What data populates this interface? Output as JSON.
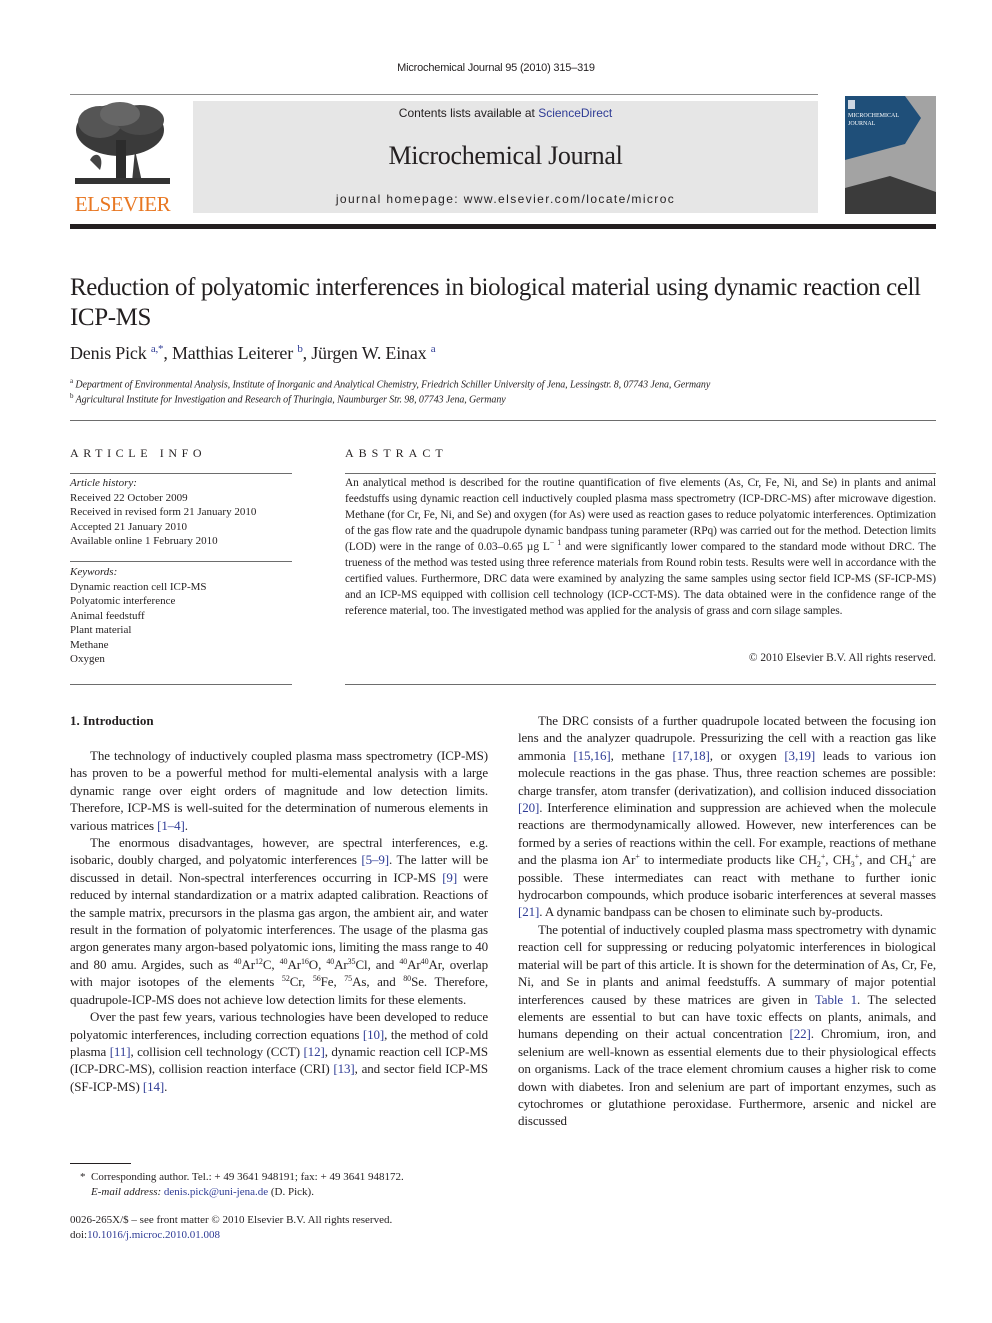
{
  "header": {
    "running_head": "Microchemical Journal 95 (2010) 315–319",
    "contents_prefix": "Contents lists available at ",
    "contents_link": "ScienceDirect",
    "journal_name": "Microchemical Journal",
    "homepage_prefix": "journal homepage: ",
    "homepage_url": "www.elsevier.com/locate/microc",
    "publisher_logo_text": "ELSEVIER",
    "cover_title_line1": "MICROCHEMICAL",
    "cover_title_line2": "JOURNAL",
    "colors": {
      "publisher_orange": "#e87722",
      "link_blue": "#2e3b95",
      "cover_blue": "#1f4f79",
      "banner_gray": "#e6e6e6"
    }
  },
  "article": {
    "title": "Reduction of polyatomic interferences in biological material using dynamic reaction cell ICP-MS",
    "authors": [
      {
        "name": "Denis Pick",
        "marks": "a,*"
      },
      {
        "name": "Matthias Leiterer",
        "marks": "b"
      },
      {
        "name": "Jürgen W. Einax",
        "marks": "a"
      }
    ],
    "affiliations": [
      {
        "mark": "a",
        "text": "Department of Environmental Analysis, Institute of Inorganic and Analytical Chemistry, Friedrich Schiller University of Jena, Lessingstr. 8, 07743 Jena, Germany"
      },
      {
        "mark": "b",
        "text": "Agricultural Institute for Investigation and Research of Thuringia, Naumburger Str. 98, 07743 Jena, Germany"
      }
    ]
  },
  "article_info": {
    "heading": "ARTICLE INFO",
    "history_label": "Article history:",
    "history": [
      "Received 22 October 2009",
      "Received in revised form 21 January 2010",
      "Accepted 21 January 2010",
      "Available online 1 February 2010"
    ],
    "keywords_label": "Keywords:",
    "keywords": [
      "Dynamic reaction cell ICP-MS",
      "Polyatomic interference",
      "Animal feedstuff",
      "Plant material",
      "Methane",
      "Oxygen"
    ]
  },
  "abstract": {
    "heading": "ABSTRACT",
    "text_part1": "An analytical method is described for the routine quantification of five elements (As, Cr, Fe, Ni, and Se) in plants and animal feedstuffs using dynamic reaction cell inductively coupled plasma mass spectrometry (ICP-DRC-MS) after microwave digestion. Methane (for Cr, Fe, Ni, and Se) and oxygen (for As) were used as reaction gases to reduce polyatomic interferences. Optimization of the gas flow rate and the quadrupole dynamic bandpass tuning parameter (RPq) was carried out for the method. Detection limits (LOD) were in the range of 0.03–0.65 µg L",
    "unit_exponent": "− 1",
    "text_part2": " and were significantly lower compared to the standard mode without DRC. The trueness of the method was tested using three reference materials from Round robin tests. Results were well in accordance with the certified values. Furthermore, DRC data were examined by analyzing the same samples using sector field ICP-MS (SF-ICP-MS) and an ICP-MS equipped with collision cell technology (ICP-CCT-MS). The data obtained were in the confidence range of the reference material, too. The investigated method was applied for the analysis of grass and corn silage samples.",
    "copyright": "© 2010 Elsevier B.V. All rights reserved."
  },
  "body": {
    "section_heading": "1. Introduction",
    "left": {
      "p1_text": "The technology of inductively coupled plasma mass spectrometry (ICP-MS) has proven to be a powerful method for multi-elemental analysis with a large dynamic range over eight orders of magnitude and low detection limits. Therefore, ICP-MS is well-suited for the determination of numerous elements in various matrices ",
      "p1_ref": "[1–4]",
      "p2_a": "The enormous disadvantages, however, are spectral interferences, e.g. isobaric, doubly charged, and polyatomic interferences ",
      "p2_ref1": "[5–9]",
      "p2_b": ". The latter will be discussed in detail. Non-spectral interferences occurring in ICP-MS ",
      "p2_ref2": "[9]",
      "p2_c": " were reduced by internal standardization or a matrix adapted calibration. Reactions of the sample matrix, precursors in the plasma gas argon, the ambient air, and water result in the formation of polyatomic interferences. The usage of the plasma gas argon generates many argon-based polyatomic ions, limiting the mass range to 40 and 80 amu. Argides, such as ",
      "argides": [
        {
          "m1": "40",
          "e1": "Ar",
          "m2": "12",
          "e2": "C"
        },
        {
          "m1": "40",
          "e1": "Ar",
          "m2": "16",
          "e2": "O"
        },
        {
          "m1": "40",
          "e1": "Ar",
          "m2": "35",
          "e2": "Cl"
        },
        {
          "m1": "40",
          "e1": "Ar",
          "m2": "40",
          "e2": "Ar"
        }
      ],
      "isotopes": [
        {
          "m": "52",
          "e": "Cr"
        },
        {
          "m": "56",
          "e": "Fe"
        },
        {
          "m": "75",
          "e": "As"
        },
        {
          "m": "80",
          "e": "Se"
        }
      ],
      "p2_d": ", overlap with major isotopes of the elements ",
      "p2_e": ". Therefore, quadrupole-ICP-MS does not achieve low detection limits for these elements.",
      "p3_a": "Over the past few years, various technologies have been developed to reduce polyatomic interferences, including correction equations ",
      "p3_ref1": "[10]",
      "p3_b": ", the method of cold plasma ",
      "p3_ref2": "[11]",
      "p3_c": ", collision cell technology (CCT) ",
      "p3_ref3": "[12]",
      "p3_d": ", dynamic reaction cell ICP-MS (ICP-DRC-MS), collision reaction interface (CRI) ",
      "p3_ref4": "[13]",
      "p3_e": ", and sector field ICP-MS (SF-ICP-MS) ",
      "p3_ref5": "[14]",
      "p3_f": "."
    },
    "right": {
      "p1_a": "The DRC consists of a further quadrupole located between the focusing ion lens and the analyzer quadrupole. Pressurizing the cell with a reaction gas like ammonia ",
      "p1_ref1": "[15,16]",
      "p1_b": ", methane ",
      "p1_ref2": "[17,18]",
      "p1_c": ", or oxygen ",
      "p1_ref3": "[3,19]",
      "p1_d": " leads to various ion molecule reactions in the gas phase. Thus, three reaction schemes are possible: charge transfer, atom transfer (derivatization), and collision induced dissociation ",
      "p1_ref4": "[20]",
      "p1_e": ". Interference elimination and suppression are achieved when the molecule reactions are thermodynamically allowed. However, new interferences can be formed by a series of reactions within the cell. For example, reactions of methane and the plasma ion Ar",
      "p1_f": " to intermediate products like CH",
      "p1_g": ", CH",
      "p1_h": ", and CH",
      "p1_i": " are possible. These intermediates can react with methane to further ionic hydrocarbon compounds, which produce isobaric interferences at several masses ",
      "p1_ref5": "[21]",
      "p1_j": ". A dynamic bandpass can be chosen to eliminate such by-products.",
      "p2_a": "The potential of inductively coupled plasma mass spectrometry with dynamic reaction cell for suppressing or reducing polyatomic interferences in biological material will be part of this article. It is shown for the determination of As, Cr, Fe, Ni, and Se in plants and animal feedstuffs. A summary of major potential interferences caused by these matrices are given in ",
      "p2_table_ref": "Table 1",
      "p2_b": ". The selected elements are essential to but can have toxic effects on plants, animals, and humans depending on their actual concentration ",
      "p2_ref": "[22]",
      "p2_c": ". Chromium, iron, and selenium are well-known as essential elements due to their physiological effects on organisms. Lack of the trace element chromium causes a higher risk to come down with diabetes. Iron and selenium are part of important enzymes, such as cytochromes or glutathione peroxidase. Furthermore, arsenic and nickel are discussed",
      "plus": "+",
      "sub2": "2",
      "sub3": "3",
      "sub4": "4"
    }
  },
  "footer": {
    "footnote_mark": "*",
    "footnote_text": "Corresponding author. Tel.: + 49 3641 948191; fax: + 49 3641 948172.",
    "email_label": "E-mail address: ",
    "email": "denis.pick@uni-jena.de",
    "email_suffix": " (D. Pick).",
    "issn_line": "0026-265X/$ – see front matter © 2010 Elsevier B.V. All rights reserved.",
    "doi_label": "doi:",
    "doi": "10.1016/j.microc.2010.01.008"
  }
}
